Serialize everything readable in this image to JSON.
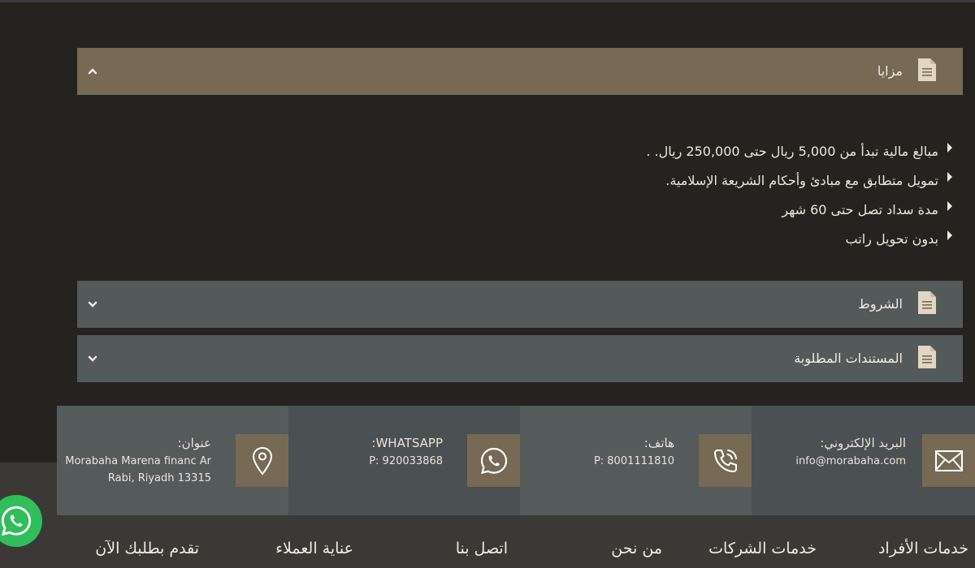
{
  "accordion": {
    "advantages": {
      "title": "مزايا",
      "state": "expanded"
    },
    "terms": {
      "title": "الشروط",
      "state": "collapsed"
    },
    "documents": {
      "title": "المستندات المطلوبة",
      "state": "collapsed"
    }
  },
  "features": [
    "مبالغ مالية تبدأ من 5,000 ريال حتى 250,000 ريال. .",
    "تمويل متطابق مع مبادئ وأحكام الشريعة الإسلامية.",
    "مدة سداد تصل حتى 60 شهر",
    "بدون تحويل راتب"
  ],
  "contact": {
    "email": {
      "label": "البريد الإلكتروني:",
      "value": "info@morabaha.com",
      "icon": "envelope-icon"
    },
    "phone": {
      "label": "هاتف:",
      "value": "P: 8001111810",
      "icon": "phone-icon"
    },
    "whatsapp": {
      "label": "WHATSAPP:",
      "value": "P: 920033868",
      "icon": "whatsapp-icon"
    },
    "address": {
      "label": "عنوان:",
      "line1": "Morabaha Marena financ Ar",
      "line2": "Rabi, Riyadh 13315",
      "icon": "map-pin-icon"
    }
  },
  "nav": {
    "individuals": "خدمات الأفراد",
    "companies": "خدمات الشركات",
    "about": "من نحن",
    "contact": "اتصل بنا",
    "customer_care": "عناية العملاء",
    "apply": "تقدم بطلبك الآن"
  },
  "colors": {
    "accent": "#766a55",
    "panel": "#545959",
    "background": "#252320",
    "whatsapp": "#2fbe5a"
  }
}
